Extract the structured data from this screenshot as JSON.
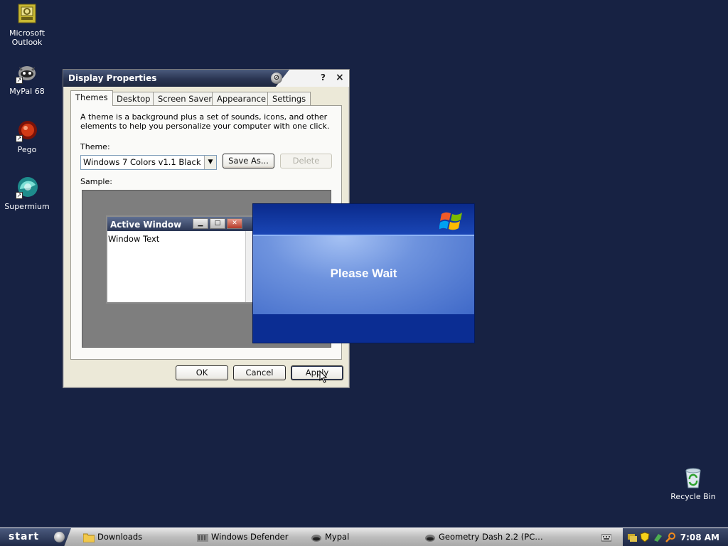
{
  "desktop": {
    "icons": [
      {
        "label": "Microsoft\nOutlook"
      },
      {
        "label": "MyPal 68"
      },
      {
        "label": "Pego"
      },
      {
        "label": "Supermium"
      },
      {
        "label": "Recycle Bin"
      }
    ]
  },
  "display_properties": {
    "title": "Display Properties",
    "help_label": "?",
    "close_label": "×",
    "tabs": [
      {
        "label": "Themes",
        "active": true
      },
      {
        "label": "Desktop"
      },
      {
        "label": "Screen Saver"
      },
      {
        "label": "Appearance"
      },
      {
        "label": "Settings"
      }
    ],
    "description": "A theme is a background plus a set of sounds, icons, and other elements to help you personalize your computer with one click.",
    "theme_label": "Theme:",
    "theme_value": "Windows 7 Colors v1.1 Black",
    "save_as_label": "Save As...",
    "delete_label": "Delete",
    "sample_label": "Sample:",
    "sample_window": {
      "title": "Active Window",
      "text": "Window Text"
    },
    "ok_label": "OK",
    "cancel_label": "Cancel",
    "apply_label": "Apply"
  },
  "wait_dialog": {
    "message": "Please Wait"
  },
  "taskbar": {
    "start_label": "start",
    "items": [
      {
        "label": "Downloads",
        "icon": "folder-icon"
      },
      {
        "label": "Windows Defender",
        "icon": "defender-icon"
      },
      {
        "label": "Mypal",
        "icon": "mypal-icon"
      },
      {
        "label": "Geometry Dash 2.2 (PC…",
        "icon": "geometry-dash-icon"
      }
    ],
    "clock": "7:08 AM"
  },
  "colors": {
    "desktop_bg": "#172243",
    "titlebar_dark": "#2a3552",
    "wait_blue": "#0b2d93"
  }
}
